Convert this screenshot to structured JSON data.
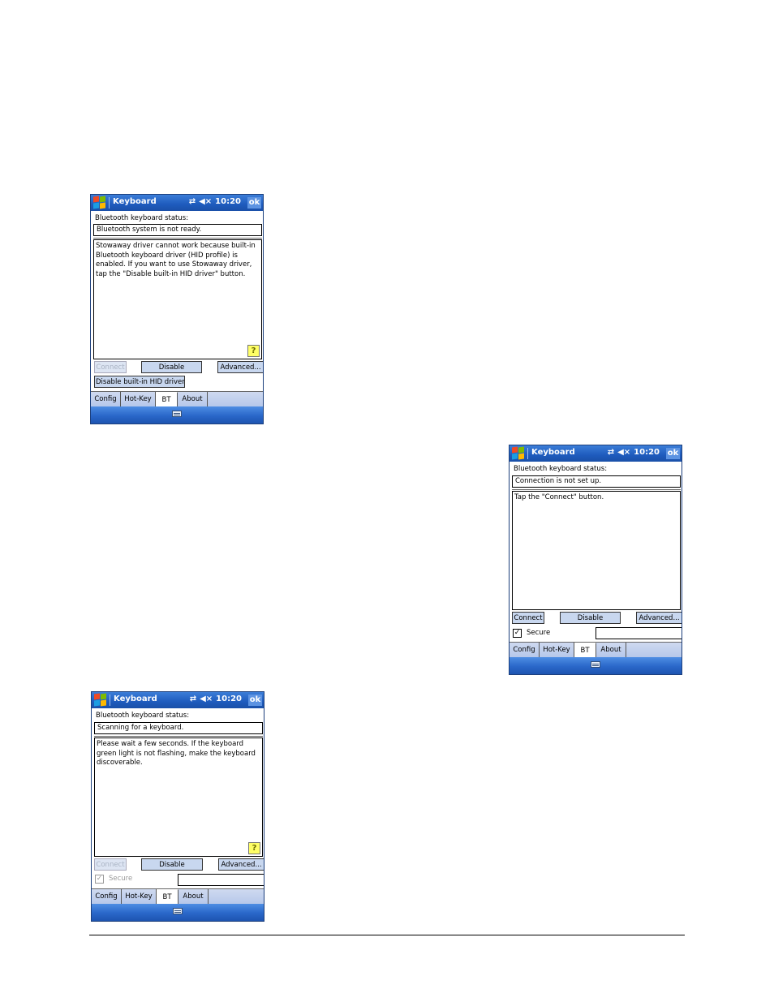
{
  "title_bar": {
    "app": "Keyboard",
    "time": "10:20",
    "ok_label": "ok",
    "icons": [
      "windows-logo",
      "connectivity-icon",
      "volume-mute-icon"
    ]
  },
  "screens": [
    {
      "status_label": "Bluetooth keyboard status:",
      "status": "Bluetooth system is not ready.",
      "message": "Stowaway driver cannot work because built-in Bluetooth keyboard driver (HID profile) is enabled. If you want to use Stowaway driver, tap the \"Disable built-in HID driver\" button.",
      "help": "?",
      "buttons": {
        "connect": "Connect",
        "disable": "Disable",
        "advanced": "Advanced..."
      },
      "extra_button": "Disable built-in HID driver",
      "tabs": [
        "Config",
        "Hot-Key",
        "BT",
        "About"
      ],
      "active_tab": "BT"
    },
    {
      "status_label": "Bluetooth keyboard status:",
      "status": "Connection is not set up.",
      "message": "Tap the \"Connect\" button.",
      "buttons": {
        "connect": "Connect",
        "disable": "Disable",
        "advanced": "Advanced..."
      },
      "secure_label": "Secure",
      "secure_checked": true,
      "tabs": [
        "Config",
        "Hot-Key",
        "BT",
        "About"
      ],
      "active_tab": "BT"
    },
    {
      "status_label": "Bluetooth keyboard status:",
      "status": "Scanning for a keyboard.",
      "message": "Please wait a few seconds. If the keyboard green light is not flashing, make the keyboard discoverable.",
      "help": "?",
      "buttons": {
        "connect": "Connect",
        "disable": "Disable",
        "advanced": "Advanced..."
      },
      "secure_label": "Secure",
      "secure_checked": true,
      "tabs": [
        "Config",
        "Hot-Key",
        "BT",
        "About"
      ],
      "active_tab": "BT"
    }
  ],
  "colors": {
    "titlebar": "#1e5bbd",
    "button": "#c8d7ef",
    "help": "#ffff66"
  }
}
